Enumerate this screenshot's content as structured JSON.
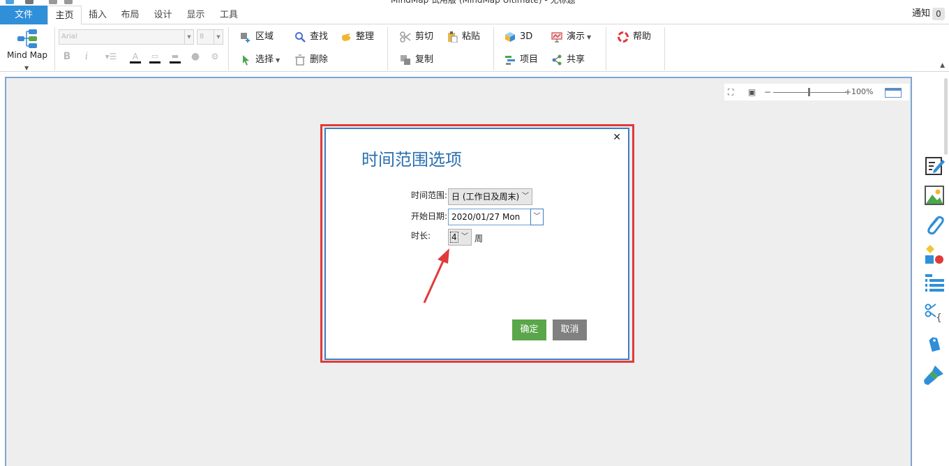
{
  "window": {
    "title": "MindMap 试用版 (MindMap Ultimate) - 无标题"
  },
  "menubar": {
    "file": "文件",
    "tabs": [
      {
        "label": "主页",
        "active": true
      },
      {
        "label": "插入"
      },
      {
        "label": "布局"
      },
      {
        "label": "设计"
      },
      {
        "label": "显示"
      },
      {
        "label": "工具"
      }
    ],
    "notify_label": "通知",
    "notify_count": "0"
  },
  "ribbon": {
    "mindmap_label": "Mind Map",
    "font_name": "Arial",
    "font_size": "8",
    "buttons": {
      "region": "区域",
      "select": "选择",
      "find": "查找",
      "delete": "删除",
      "arrange": "整理",
      "cut": "剪切",
      "copy": "复制",
      "paste": "粘贴",
      "threed": "3D",
      "project": "项目",
      "present": "演示",
      "share": "共享",
      "help": "帮助"
    }
  },
  "zoom": {
    "level": "100%"
  },
  "dialog": {
    "title": "时间范围选项",
    "range_label": "时间范围:",
    "range_value": "日 (工作日及周末)",
    "start_label": "开始日期:",
    "start_value": "2020/01/27 Mon",
    "duration_label": "时长:",
    "duration_value": "4",
    "duration_unit": "周",
    "ok_label": "确定",
    "cancel_label": "取消"
  },
  "colors": {
    "accent": "#2f8fd8",
    "dialog_title": "#2b6fb0",
    "ok_button": "#5aa64a",
    "cancel_button": "#808080",
    "highlight": "#e03a3a"
  },
  "icons": {
    "sidebar": [
      "note-edit-icon",
      "image-icon",
      "attachment-icon",
      "shapes-icon",
      "outline-list-icon",
      "scissors-code-icon",
      "tag-icon",
      "brush-icon"
    ]
  }
}
